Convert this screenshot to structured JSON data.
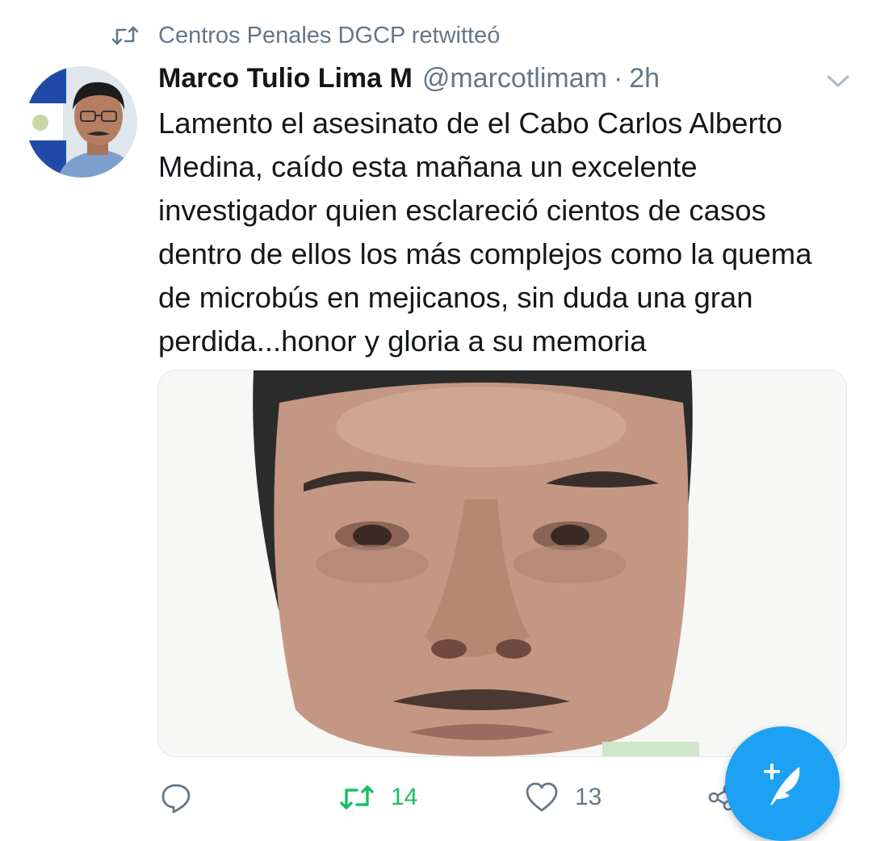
{
  "retweet_context": {
    "icon": "retweet-icon",
    "text": "Centros Penales DGCP retwitteó"
  },
  "tweet": {
    "avatar": "user-avatar",
    "display_name": "Marco Tulio Lima M",
    "handle": "@marcotlimam",
    "separator": "·",
    "time": "2h",
    "menu_icon": "chevron-down-icon",
    "text": "Lamento el asesinato de el Cabo Carlos Alberto Medina, caído esta mañana un excelente investigador quien esclareció cientos de casos dentro de ellos los más complejos como la quema de microbús en mejicanos, sin duda una gran perdida...honor y gloria a su memoria",
    "media": "face-photo"
  },
  "actions": {
    "reply": {
      "icon": "reply-icon"
    },
    "retweet": {
      "icon": "retweet-icon",
      "count": "14",
      "active": true
    },
    "like": {
      "icon": "heart-icon",
      "count": "13"
    },
    "share": {
      "icon": "share-icon"
    }
  },
  "compose_button": {
    "icon": "compose-tweet-icon"
  },
  "colors": {
    "accent": "#1da1f2",
    "retweet_active": "#17bf63",
    "secondary_text": "#657786",
    "primary_text": "#14171a"
  }
}
